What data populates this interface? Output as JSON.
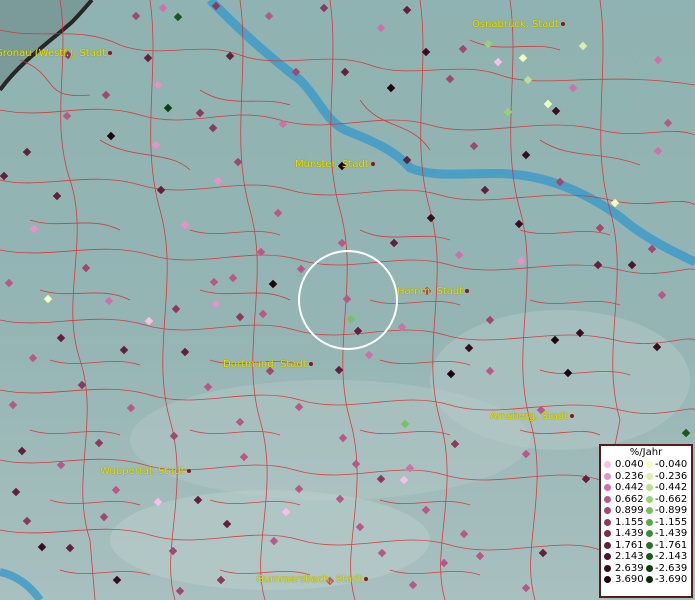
{
  "cities": [
    {
      "name": "Gronau (Westf.), Stadt"
    },
    {
      "name": "Osnabrück, Stadt"
    },
    {
      "name": "Münster, Stadt"
    },
    {
      "name": "Hamm, Stadt"
    },
    {
      "name": "Dortmund, Stadt"
    },
    {
      "name": "Arnsberg, Stadt"
    },
    {
      "name": "Wuppertal, Stadt"
    },
    {
      "name": "Gummersbach, Stadt"
    }
  ],
  "legend": {
    "title": "%/Jahr",
    "positive": [
      "0.040",
      "0.236",
      "0.442",
      "0.662",
      "0.899",
      "1.155",
      "1.439",
      "1.761",
      "2.143",
      "2.639",
      "3.690"
    ],
    "negative": [
      "-0.040",
      "-0.236",
      "-0.442",
      "-0.662",
      "-0.899",
      "-1.155",
      "-1.439",
      "-1.761",
      "-2.143",
      "-2.639",
      "-3.690"
    ],
    "positive_colors": [
      "#f8c0e8",
      "#e890c8",
      "#d070a8",
      "#b85888",
      "#a04870",
      "#8a3a5c",
      "#782e4c",
      "#62203c",
      "#4e162e",
      "#3a0c20",
      "#200510"
    ],
    "negative_colors": [
      "#f0ffc0",
      "#d8f0a8",
      "#b8e090",
      "#98d078",
      "#78c060",
      "#58a848",
      "#3c8c38",
      "#2a7028",
      "#1a5818",
      "#0e400e",
      "#062c06"
    ]
  },
  "colors": {
    "map_background": "#8fb0b0",
    "river": "#3a9ac8",
    "boundary": "#d83030",
    "city_label": "#e8e000",
    "highlight_circle": "#ffffff"
  }
}
